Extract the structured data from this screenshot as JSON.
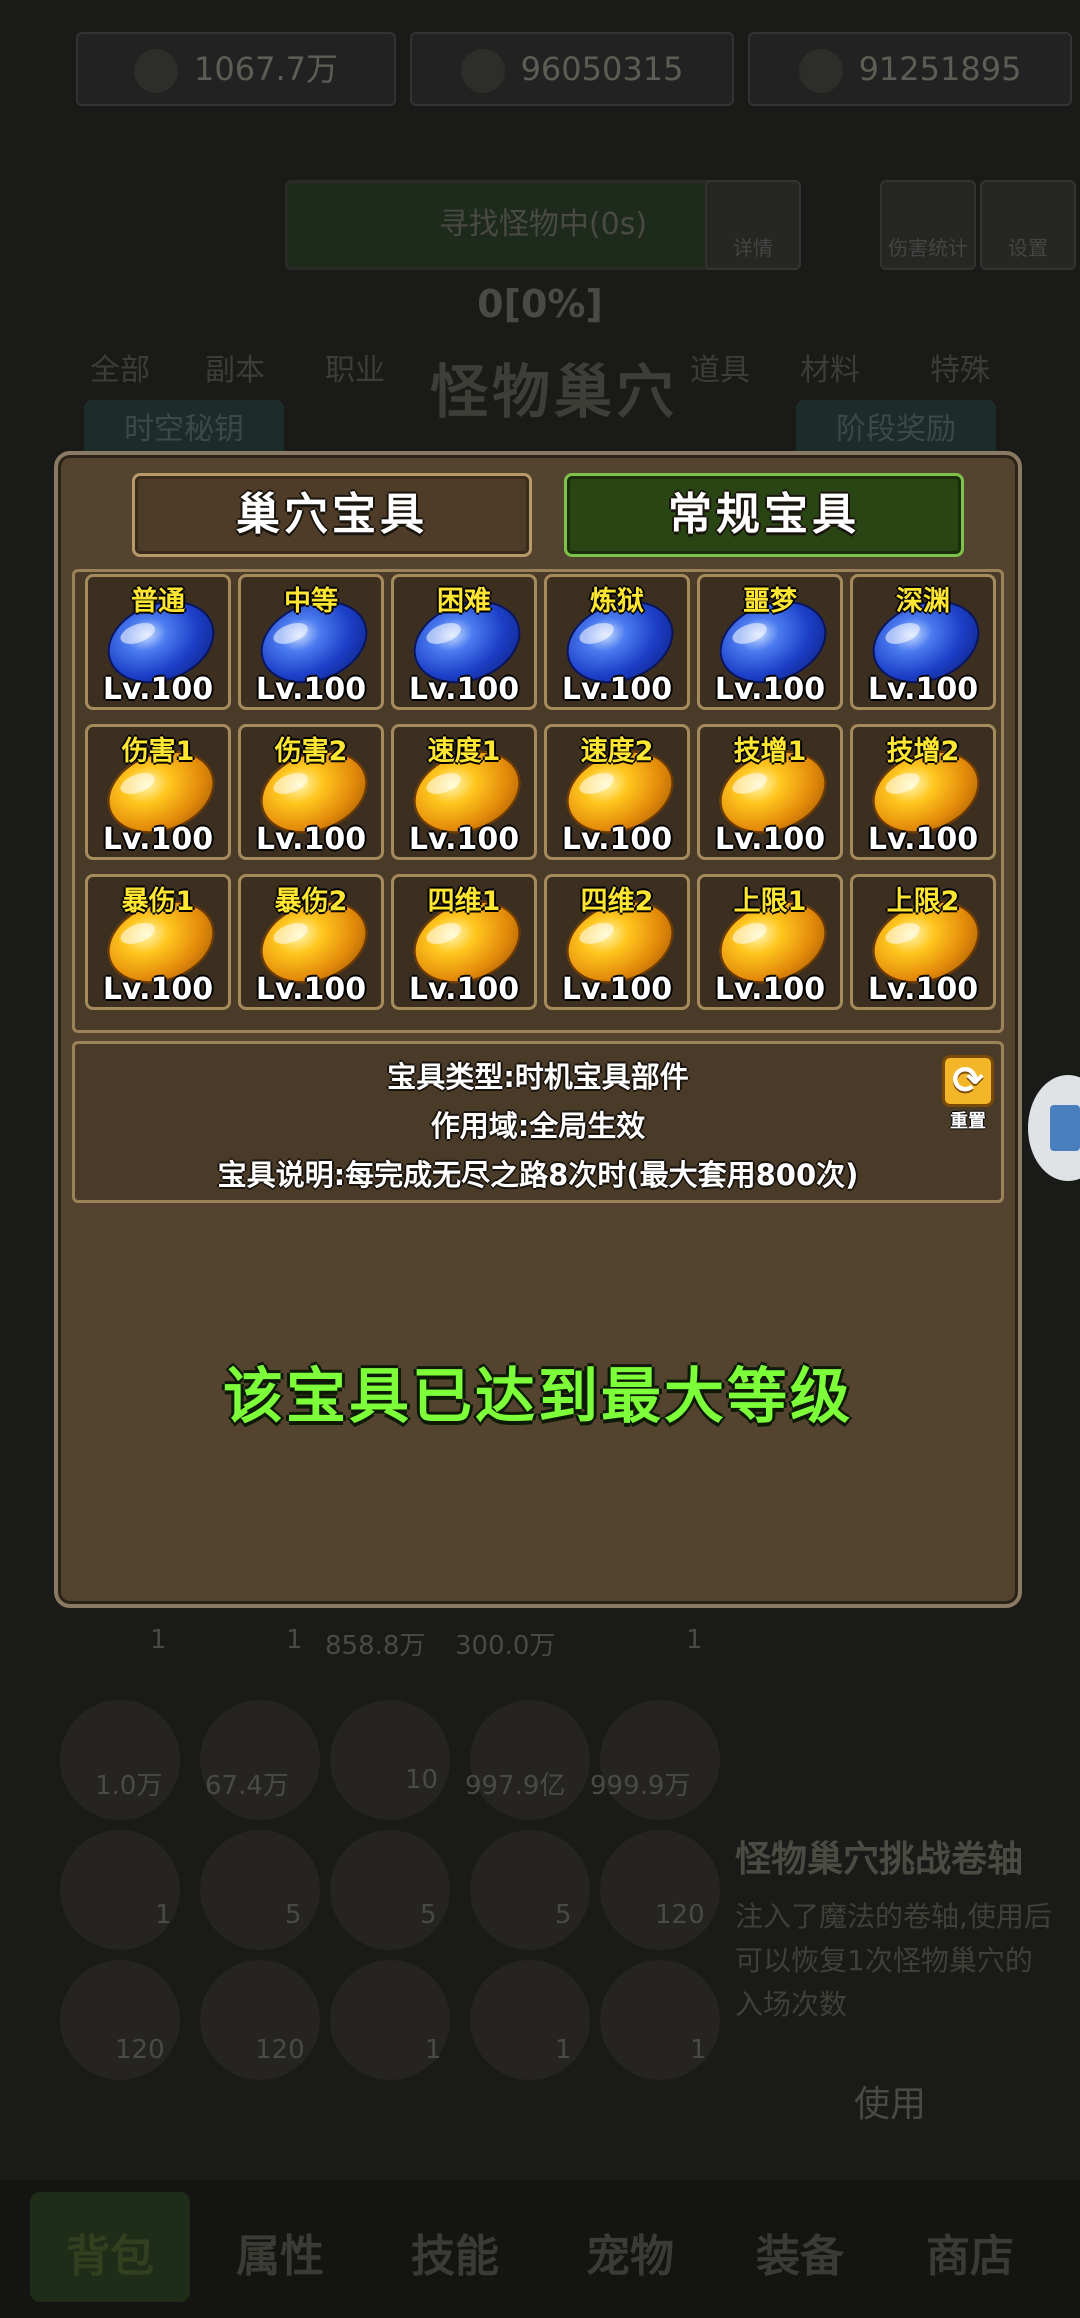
{
  "background": {
    "resources": [
      "1067.7万",
      "96050315",
      "91251895"
    ],
    "search_status": "寻找怪物中(0s)",
    "tools": [
      "详情",
      "伤害统计",
      "设置"
    ],
    "progress_text": "0[0%]",
    "tabs": [
      "全部",
      "副本",
      "职业",
      "道具",
      "材料",
      "特殊"
    ],
    "nest_title": "怪物巢穴",
    "left_button": "时空秘钥",
    "right_button": "阶段奖励",
    "counts_row1": [
      "1",
      "1",
      "858.8万",
      "300.0万",
      "1"
    ],
    "counts_row2": [
      "1.0万",
      "67.4万",
      "10",
      "997.9亿",
      "999.9万"
    ],
    "counts_row3": [
      "1",
      "5",
      "5",
      "5",
      "120"
    ],
    "counts_row4": [
      "120",
      "120",
      "1",
      "1",
      "1"
    ],
    "scroll_title": "怪物巢穴挑战卷轴",
    "scroll_desc": "注入了魔法的卷轴,使用后可以恢复1次怪物巢穴的入场次数",
    "use_label": "使用",
    "bottom_nav": [
      "背包",
      "属性",
      "技能",
      "宠物",
      "装备",
      "商店"
    ]
  },
  "dialog": {
    "tabs": {
      "nest_treasure": "巢穴宝具",
      "normal_treasure": "常规宝具"
    },
    "items": [
      {
        "name": "普通",
        "level": "Lv.100",
        "color": "blue"
      },
      {
        "name": "中等",
        "level": "Lv.100",
        "color": "blue"
      },
      {
        "name": "困难",
        "level": "Lv.100",
        "color": "blue"
      },
      {
        "name": "炼狱",
        "level": "Lv.100",
        "color": "blue"
      },
      {
        "name": "噩梦",
        "level": "Lv.100",
        "color": "blue"
      },
      {
        "name": "深渊",
        "level": "Lv.100",
        "color": "blue"
      },
      {
        "name": "伤害1",
        "level": "Lv.100",
        "color": "gold"
      },
      {
        "name": "伤害2",
        "level": "Lv.100",
        "color": "gold"
      },
      {
        "name": "速度1",
        "level": "Lv.100",
        "color": "gold"
      },
      {
        "name": "速度2",
        "level": "Lv.100",
        "color": "gold"
      },
      {
        "name": "技增1",
        "level": "Lv.100",
        "color": "gold"
      },
      {
        "name": "技增2",
        "level": "Lv.100",
        "color": "gold"
      },
      {
        "name": "暴伤1",
        "level": "Lv.100",
        "color": "gold"
      },
      {
        "name": "暴伤2",
        "level": "Lv.100",
        "color": "gold"
      },
      {
        "name": "四维1",
        "level": "Lv.100",
        "color": "gold"
      },
      {
        "name": "四维2",
        "level": "Lv.100",
        "color": "gold"
      },
      {
        "name": "上限1",
        "level": "Lv.100",
        "color": "gold"
      },
      {
        "name": "上限2",
        "level": "Lv.100",
        "color": "gold"
      }
    ],
    "info": {
      "type": "宝具类型:时机宝具部件",
      "scope": "作用域:全局生效",
      "desc": "宝具说明:每完成无尽之路8次时(最大套用800次)"
    },
    "reset_label": "重置",
    "max_message": "该宝具已达到最大等级"
  }
}
